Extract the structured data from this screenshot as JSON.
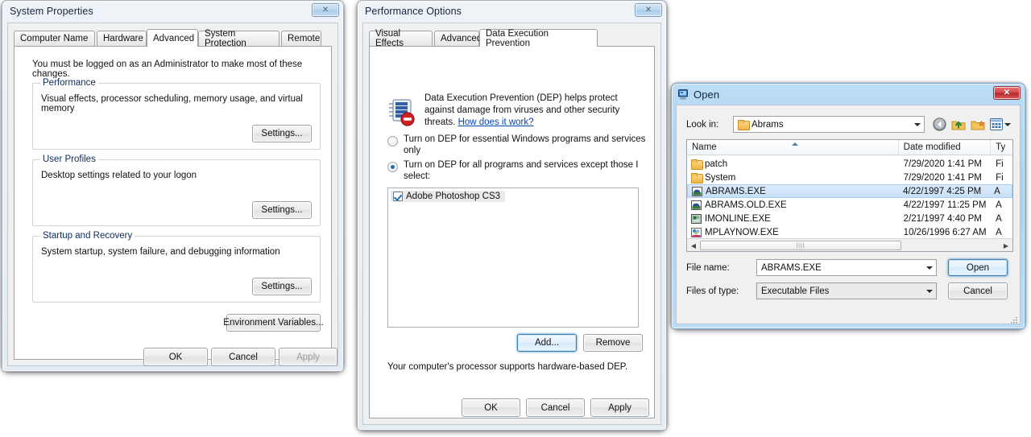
{
  "sysprops": {
    "title": "System Properties",
    "close_label": "✕",
    "tabs": [
      {
        "label": "Computer Name",
        "active": false
      },
      {
        "label": "Hardware",
        "active": false
      },
      {
        "label": "Advanced",
        "active": true
      },
      {
        "label": "System Protection",
        "active": false
      },
      {
        "label": "Remote",
        "active": false
      }
    ],
    "admin_note": "You must be logged on as an Administrator to make most of these changes.",
    "groups": [
      {
        "legend": "Performance",
        "text": "Visual effects, processor scheduling, memory usage, and virtual memory",
        "button": "Settings..."
      },
      {
        "legend": "User Profiles",
        "text": "Desktop settings related to your logon",
        "button": "Settings..."
      },
      {
        "legend": "Startup and Recovery",
        "text": "System startup, system failure, and debugging information",
        "button": "Settings..."
      }
    ],
    "env_button": "Environment Variables...",
    "footer": {
      "ok": "OK",
      "cancel": "Cancel",
      "apply": "Apply"
    }
  },
  "perfopts": {
    "title": "Performance Options",
    "close_label": "✕",
    "tabs": [
      {
        "label": "Visual Effects",
        "active": false
      },
      {
        "label": "Advanced",
        "active": false
      },
      {
        "label": "Data Execution Prevention",
        "active": true
      }
    ],
    "dep_icon": "dep-shield-icon",
    "intro_line1": "Data Execution Prevention (DEP) helps protect",
    "intro_line2": "against damage from viruses and other security",
    "intro_line3_pre": "threats. ",
    "intro_link": "How does it work?",
    "radios": [
      {
        "line1": "Turn on DEP for essential Windows programs and services",
        "line2": "only",
        "checked": false
      },
      {
        "line1": "Turn on DEP for all programs and services except those I",
        "line2": "select:",
        "checked": true
      }
    ],
    "exception_list": [
      {
        "label": "Adobe Photoshop CS3",
        "checked": true,
        "selected": true
      }
    ],
    "add_button": "Add...",
    "remove_button": "Remove",
    "support_note": "Your computer's processor supports hardware-based DEP.",
    "footer": {
      "ok": "OK",
      "cancel": "Cancel",
      "apply": "Apply"
    }
  },
  "opendlg": {
    "title": "Open",
    "title_icon": "monitor-icon",
    "close_label": "✕",
    "lookin_label": "Look in:",
    "lookin_value": "Abrams",
    "toolbar": [
      {
        "name": "back-icon",
        "glyph": "←"
      },
      {
        "name": "up-folder-icon",
        "glyph": "↑"
      },
      {
        "name": "new-folder-icon",
        "glyph": "✦"
      },
      {
        "name": "views-icon",
        "glyph": "▦"
      }
    ],
    "columns": [
      {
        "label": "Name",
        "sorted": true
      },
      {
        "label": "Date modified",
        "sorted": false
      },
      {
        "label": "Ty",
        "sorted": false
      }
    ],
    "files": [
      {
        "name": "patch",
        "icon": "folder-icon",
        "date": "7/29/2020 1:41 PM",
        "type": "Fi",
        "selected": false
      },
      {
        "name": "System",
        "icon": "folder-icon",
        "date": "7/29/2020 1:41 PM",
        "type": "Fi",
        "selected": false
      },
      {
        "name": "ABRAMS.EXE",
        "icon": "tank-app-icon",
        "date": "4/22/1997 4:25 PM",
        "type": "A",
        "selected": true
      },
      {
        "name": "ABRAMS.OLD.EXE",
        "icon": "tank-app-icon",
        "date": "4/22/1997 11:25 PM",
        "type": "A",
        "selected": false
      },
      {
        "name": "IMONLINE.EXE",
        "icon": "window-app-icon",
        "date": "2/21/1997 4:40 PM",
        "type": "A",
        "selected": false
      },
      {
        "name": "MPLAYNOW.EXE",
        "icon": "media-app-icon",
        "date": "10/26/1996 6:27 AM",
        "type": "A",
        "selected": false
      }
    ],
    "filename_label": "File name:",
    "filename_value": "ABRAMS.EXE",
    "filetype_label": "Files of type:",
    "filetype_value": "Executable Files",
    "open_button": "Open",
    "cancel_button": "Cancel"
  },
  "colors": {
    "accent": "#3c7fb1",
    "selection": "#c7e0f8",
    "link": "#0645ad",
    "close_red": "#b7282c",
    "legend_text": "#0b2c5c"
  }
}
